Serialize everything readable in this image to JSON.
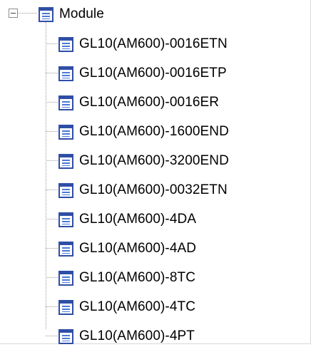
{
  "tree": {
    "root": {
      "label": "Module",
      "icon": "document-icon",
      "expanded": true
    },
    "children": [
      {
        "label": "GL10(AM600)-0016ETN",
        "icon": "document-icon"
      },
      {
        "label": "GL10(AM600)-0016ETP",
        "icon": "document-icon"
      },
      {
        "label": "GL10(AM600)-0016ER",
        "icon": "document-icon"
      },
      {
        "label": "GL10(AM600)-1600END",
        "icon": "document-icon"
      },
      {
        "label": "GL10(AM600)-3200END",
        "icon": "document-icon"
      },
      {
        "label": "GL10(AM600)-0032ETN",
        "icon": "document-icon"
      },
      {
        "label": "GL10(AM600)-4DA",
        "icon": "document-icon"
      },
      {
        "label": "GL10(AM600)-4AD",
        "icon": "document-icon"
      },
      {
        "label": "GL10(AM600)-8TC",
        "icon": "document-icon"
      },
      {
        "label": "GL10(AM600)-4TC",
        "icon": "document-icon"
      },
      {
        "label": "GL10(AM600)-4PT",
        "icon": "document-icon"
      }
    ]
  },
  "colors": {
    "icon_border": "#2f4ea6",
    "icon_lines": "#4b79d8",
    "connector": "#9a9a9a",
    "text": "#000000"
  }
}
